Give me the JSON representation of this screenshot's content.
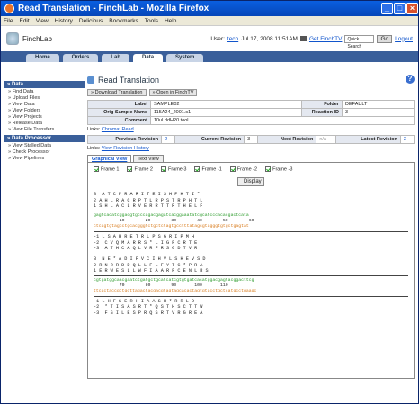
{
  "window": {
    "title": "Read Translation - FinchLab - Mozilla Firefox"
  },
  "menu": [
    "File",
    "Edit",
    "View",
    "History",
    "Delicious",
    "Bookmarks",
    "Tools",
    "Help"
  ],
  "app": {
    "name": "FinchLab",
    "user_label": "User:",
    "user": "tech",
    "date": "Jul 17, 2008 11:51AM",
    "finchtv_link": "Get FinchTV",
    "search_placeholder": "Quick Search",
    "go": "Go",
    "logout": "Logout"
  },
  "tabs": [
    {
      "label": "Home"
    },
    {
      "label": "Orders"
    },
    {
      "label": "Lab"
    },
    {
      "label": "Data"
    },
    {
      "label": "System"
    }
  ],
  "sidebar": {
    "data_header": "Data",
    "data_items": [
      "Find Data",
      "Upload Files",
      "View Data",
      "View Folders",
      "View Projects",
      "Release Data",
      "View File Transfers"
    ],
    "proc_header": "Data Processor",
    "proc_items": [
      "View Stalled Data",
      "Check Processor",
      "View Pipelines"
    ]
  },
  "page": {
    "title": "Read Translation",
    "download_btn": "Download Translation",
    "finchtv_btn": "Open in FinchTV"
  },
  "info": {
    "label_k": "Label",
    "label_v": "SAMPLE02",
    "folder_k": "Folder",
    "folder_v": "DEFAULT",
    "sample_k": "Orig Sample Name",
    "sample_v": "115A24_2001.s1",
    "reaction_k": "Reaction ID",
    "reaction_v": "3",
    "comment_k": "Comment",
    "comment_v": "10ul ddH20 tool"
  },
  "links1": {
    "label": "Links:",
    "link": "Chromat Read"
  },
  "revisions": {
    "prev_k": "Previous Revision",
    "prev_v": "2",
    "cur_k": "Current Revision",
    "cur_v": "3",
    "next_k": "Next Revision",
    "next_v": "n/a",
    "latest_k": "Latest Revision",
    "latest_v": "2"
  },
  "links2": {
    "label": "Links:",
    "link": "View Revision History"
  },
  "view_tabs": [
    "Graphical View",
    "Text View"
  ],
  "frames": [
    "Frame 1",
    "Frame 2",
    "Frame 3",
    "Frame -1",
    "Frame -2",
    "Frame -3"
  ],
  "display_btn": "Display",
  "block1": {
    "aa1": "3  A T C P R A R I T E I S H P H T I *",
    "aa2": "2 A H L R A C R P T L R P S T R P H T L",
    "aa3": "1 S H L A C L R V E R R T T R T H E L F",
    "dna": "gagtcacatcggacgtgcccagacgagatcacggaaatatcgcatcccacacgactcata",
    "nums": "          10        20        30        40        50        60",
    "dnac": "ctcagtgtagcctgcacgggtctgctctagtgcctttatagcgtagggtgtgctgagtat",
    "raa1": "-1 L S A H R E T R L P S G R I P M H",
    "raa2": "-2  C V Q M A R R S * L I G F C R T E",
    "raa3": "-3  A T H C A Q L V R F R S G D T V R"
  },
  "block2": {
    "aa1": "3  N E * A D I F V C I H V L S H E V S D",
    "aa2": "2 R N R R D D Q L L F L F Y T C * P R A",
    "aa3": "1 E R W E S L L W F I A A R F C E N L R S",
    "dna": "cgtgatggcaacgaatctgatgctgcatcatcgtgtgatcacatggacgagtacggacttcg",
    "nums": "          70        80        90       100       110",
    "dnac": "ttcactaccgttgcttagactacgacgtagtagcacactagtgtacctgctcatgcctgaagc",
    "raa1": "-1 L H F S E R H I A A S H * R R L D",
    "raa2": "-2  * T I S A S R T * Q S T H S C T T W",
    "raa3": "-3  F S I L E S P R Q S R T V R G R E A"
  }
}
